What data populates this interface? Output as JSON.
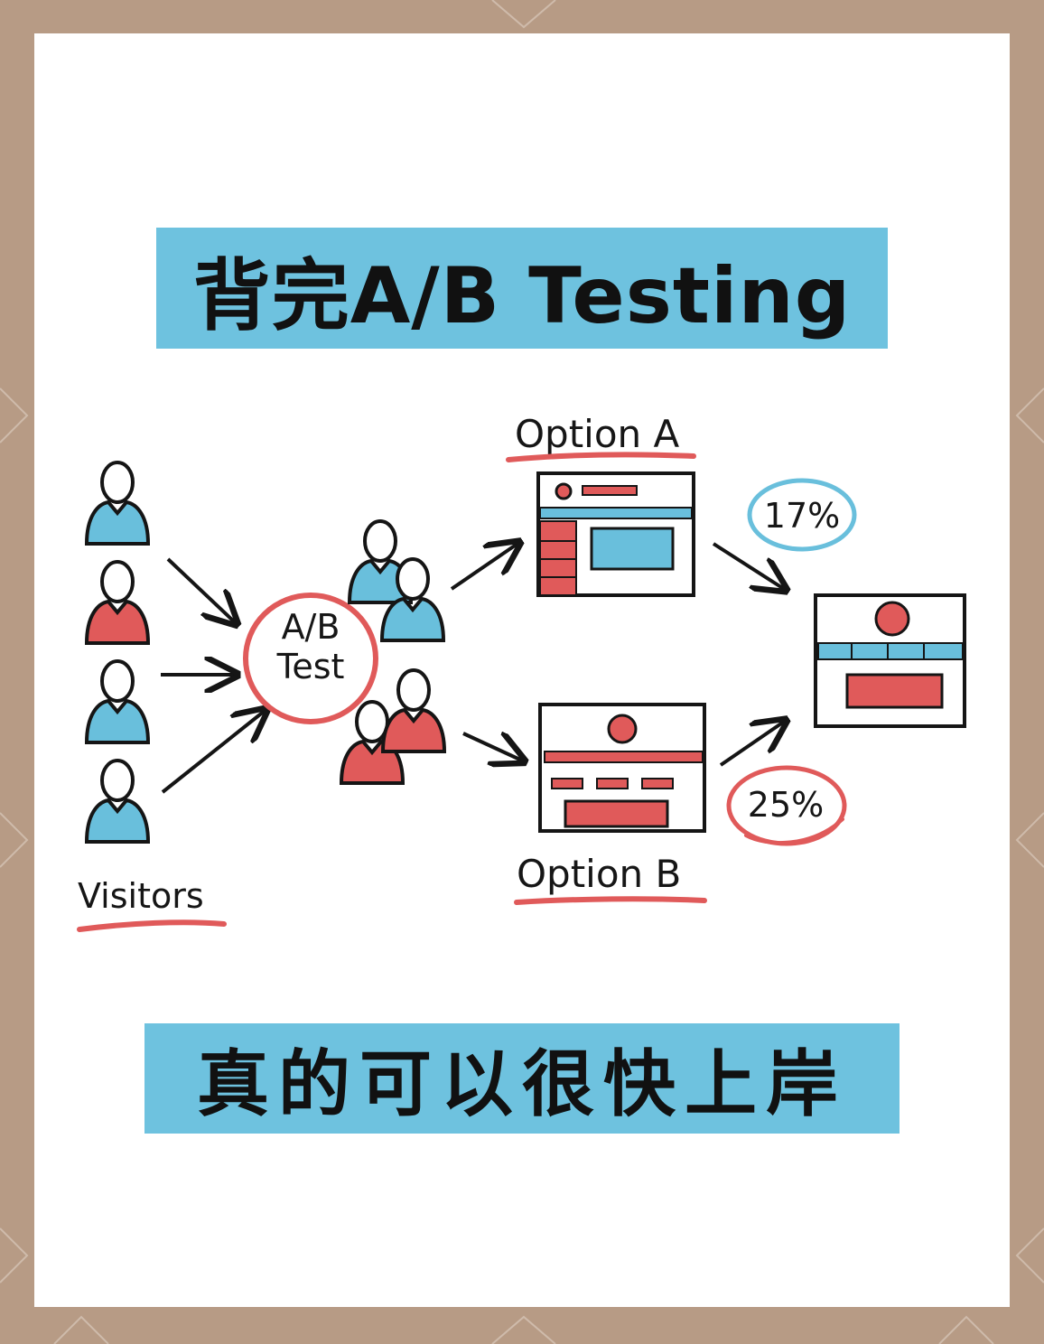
{
  "title": "背完A/B Testing",
  "subtitle": "真的可以很快上岸",
  "diagram": {
    "visitors_label": "Visitors",
    "test_label_line1": "A/B",
    "test_label_line2": "Test",
    "option_a_label": "Option A",
    "option_b_label": "Option B",
    "option_a_rate": "17%",
    "option_b_rate": "25%"
  },
  "colors": {
    "accent_blue": "#6ec2df",
    "accent_red": "#e05a5a",
    "outer_frame": "#b79b85",
    "card": "#ffffff"
  },
  "icons": [
    "person-icon",
    "arrow-icon",
    "webpage-wireframe-icon"
  ]
}
